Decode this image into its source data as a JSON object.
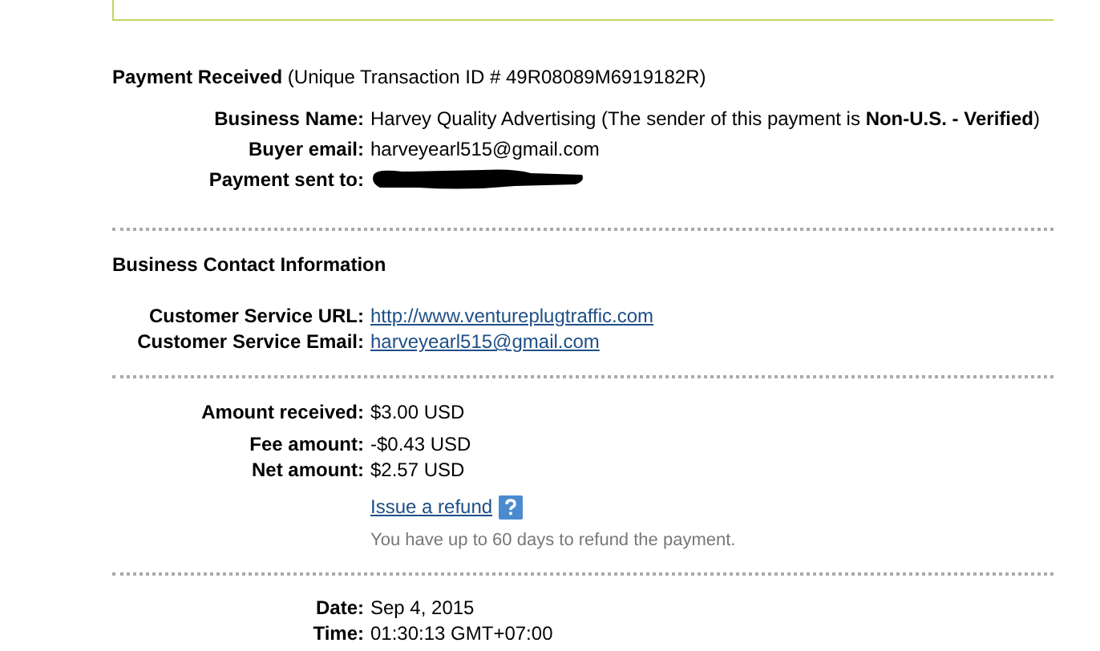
{
  "payment": {
    "title": "Payment Received",
    "transaction": "(Unique Transaction ID # 49R08089M6919182R)"
  },
  "details": [
    {
      "label": "Business Name:",
      "kind": "text",
      "value": "Harvey Quality Advertising (The sender of this payment is **Non-U.S. - Verified**)"
    },
    {
      "label": "Buyer email:",
      "kind": "text",
      "value": "harveyearl515@gmail.com"
    },
    {
      "label": "Payment sent to:",
      "kind": "redacted"
    }
  ],
  "contact": {
    "title": "Business Contact Information",
    "rows": [
      {
        "label": "Customer Service URL:",
        "kind": "link",
        "value": "http://www.ventureplugtraffic.com"
      },
      {
        "label": "Customer Service Email:",
        "kind": "link",
        "value": "harveyearl515@gmail.com"
      }
    ]
  },
  "amounts": {
    "rows": [
      {
        "label": "Amount received:",
        "kind": "text",
        "value": "$3.00 USD"
      },
      {
        "label": "Fee amount:",
        "kind": "text",
        "value": "-$0.43 USD"
      },
      {
        "label": "Net amount:",
        "kind": "text",
        "value": "$2.57 USD"
      }
    ],
    "refund_link": "Issue a refund",
    "refund_note": "You have up to 60 days to refund the payment."
  },
  "timing": {
    "rows": [
      {
        "label": "Date:",
        "kind": "text",
        "value": "Sep 4, 2015"
      },
      {
        "label": "Time:",
        "kind": "text",
        "value": "01:30:13 GMT+07:00"
      }
    ]
  }
}
